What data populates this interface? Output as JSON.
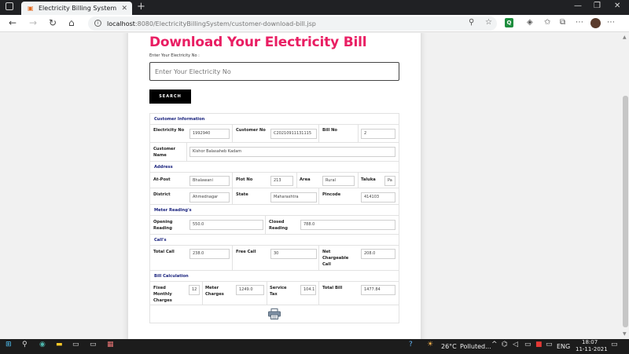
{
  "browser": {
    "tab_title": "Electricity Billing System",
    "url_host": "localhost",
    "url_path": ":8080/ElectricityBillingSystem/customer-download-bill.jsp"
  },
  "page": {
    "title": "Download Your Electricity Bill",
    "enter_label": "Enter Your Electricity No :",
    "search_placeholder": "Enter Your Electricity No",
    "search_button": "SEARCH"
  },
  "bill": {
    "customer_info": {
      "heading": "Customer Information",
      "electricity_no_label": "Electricity No",
      "electricity_no": "1992940",
      "customer_no_label": "Customer No",
      "customer_no": "C20210911131115",
      "bill_no_label": "Bill No",
      "bill_no": "2",
      "customer_name_label": "Customer Name",
      "customer_name": "Kishor Balasaheb Kadam"
    },
    "address": {
      "heading": "Address",
      "at_post_label": "At-Post",
      "at_post": "Bhalawani",
      "plot_no_label": "Plot No",
      "plot_no": "213",
      "area_label": "Area",
      "area": "Rural",
      "taluka_label": "Taluka",
      "taluka": "Pa",
      "district_label": "District",
      "district": "Ahmednagar",
      "state_label": "State",
      "state": "Maharashtra",
      "pincode_label": "Pincode",
      "pincode": "414103"
    },
    "meter": {
      "heading": "Meter Reading's",
      "opening_label": "Opening Reading",
      "opening": "550.0",
      "closed_label": "Closed Reading",
      "closed": "788.0"
    },
    "calls": {
      "heading": "Call's",
      "total_call_label": "Total Call",
      "total_call": "238.0",
      "free_call_label": "Free Call",
      "free_call": "30",
      "net_label": "Net Chargeable Call",
      "net": "208.0"
    },
    "calculation": {
      "heading": "Bill Calculation",
      "fixed_label": "Fixed Monthly Charges",
      "fixed": "12",
      "meter_charges_label": "Meter Charges",
      "meter_charges": "1249.0",
      "service_tax_label": "Service Tax",
      "service_tax": "104.1",
      "total_bill_label": "Total Bill",
      "total_bill": "1477.84"
    }
  },
  "taskbar": {
    "weather": "26°C",
    "weather_status": "Polluted...",
    "lang": "ENG",
    "time": "18:07",
    "date": "11-11-2021"
  }
}
